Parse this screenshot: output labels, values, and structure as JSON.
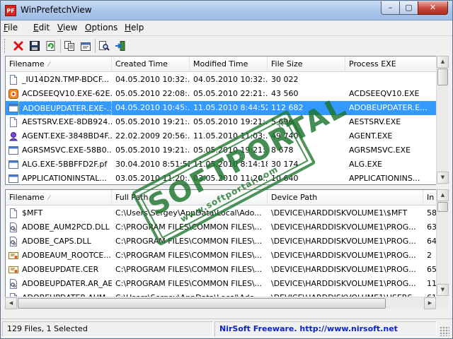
{
  "window": {
    "title": "WinPrefetchView",
    "app_icon_text": "PF",
    "minimize_glyph": "–",
    "maximize_glyph": "▢",
    "close_glyph": "✕"
  },
  "menu": {
    "items": [
      {
        "label": "File",
        "accel": "F"
      },
      {
        "label": "Edit",
        "accel": "E"
      },
      {
        "label": "View",
        "accel": "V"
      },
      {
        "label": "Options",
        "accel": "O"
      },
      {
        "label": "Help",
        "accel": "H"
      }
    ]
  },
  "toolbar": {
    "buttons": [
      {
        "name": "delete-button",
        "icon": "red-x-icon"
      },
      {
        "name": "save-button",
        "icon": "floppy-disk-icon"
      },
      {
        "name": "refresh-button",
        "icon": "refresh-icon"
      },
      {
        "name": "copy-button",
        "icon": "copy-icon"
      },
      {
        "name": "properties-button",
        "icon": "properties-icon"
      },
      {
        "name": "find-button",
        "icon": "find-icon"
      },
      {
        "name": "exit-button",
        "icon": "exit-icon"
      }
    ]
  },
  "top_list": {
    "columns": [
      "Filename",
      "Created Time",
      "Modified Time",
      "File Size",
      "Process EXE"
    ],
    "sorted_column": 0,
    "rows": [
      {
        "icon": "file-icon",
        "cells": [
          "_IU14D2N.TMP-BDCF...",
          "04.05.2010 10:32:...",
          "04.05.2010 10:32:...",
          "30 022",
          ""
        ]
      },
      {
        "icon": "acdsee-icon",
        "cells": [
          "ACDSEEQV10.EXE-62E...",
          "05.05.2010 22:08:...",
          "05.05.2010 22:21:...",
          "43 560",
          "ACDSEEQV10.EXE"
        ]
      },
      {
        "icon": "app-icon",
        "cells": [
          "ADOBEUPDATER.EXE-...",
          "04.05.2010 10:45:...",
          "11.05.2010 8:44:52",
          "112 682",
          "ADOBEUPDATER.E..."
        ],
        "selected": true
      },
      {
        "icon": "file-icon",
        "cells": [
          "AESTSRV.EXE-8DB924...",
          "05.05.2010 19:21:...",
          "05.05.2010 19:21:...",
          "5 696",
          "AESTSRV.EXE"
        ]
      },
      {
        "icon": "agent-icon",
        "cells": [
          "AGENT.EXE-3848BD4F...",
          "22.02.2009 20:56:...",
          "11.05.2010 11:03:...",
          "49 740",
          "AGENT.EXE"
        ]
      },
      {
        "icon": "app-icon",
        "cells": [
          "AGRSMSVC.EXE-58B0...",
          "05.05.2010 19:21:...",
          "05.05.2010 19:21:...",
          "8 678",
          "AGRSMSVC.EXE"
        ]
      },
      {
        "icon": "app-icon",
        "cells": [
          "ALG.EXE-5BBFFD2F.pf",
          "30.04.2010 8:51:52",
          "11.05.2010 8:14:18",
          "30 174",
          "ALG.EXE"
        ]
      },
      {
        "icon": "app-icon",
        "cells": [
          "APPLICATIONINSTAL...",
          "03.05.2010 11:20:...",
          "03.05.2010 11:20:...",
          "10 640",
          "APPLICATIONINS..."
        ]
      }
    ]
  },
  "bottom_list": {
    "columns": [
      "Filename",
      "Full Path",
      "Device Path",
      "In"
    ],
    "sorted_column": 0,
    "rows": [
      {
        "icon": "file-icon",
        "cells": [
          "$MFT",
          "C:\\Users\\Sergey\\AppData\\Local\\Ado...",
          "\\DEVICE\\HARDDISKVOLUME1\\$MFT",
          "58"
        ]
      },
      {
        "icon": "dll-icon",
        "cells": [
          "ADOBE_AUM2PCD.DLL",
          "C:\\PROGRAM FILES\\COMMON FILES\\...",
          "\\DEVICE\\HARDDISKVOLUME1\\PROG...",
          "63"
        ]
      },
      {
        "icon": "dll-icon",
        "cells": [
          "ADOBE_CAPS.DLL",
          "C:\\PROGRAM FILES\\COMMON FILES\\...",
          "\\DEVICE\\HARDDISKVOLUME1\\PROG...",
          "64"
        ]
      },
      {
        "icon": "cert-icon",
        "cells": [
          "ADOBEAUM_ROOTCE...",
          "C:\\PROGRAM FILES\\COMMON FILES\\...",
          "\\DEVICE\\HARDDISKVOLUME1\\PROG...",
          "2"
        ]
      },
      {
        "icon": "cert-icon",
        "cells": [
          "ADOBEUPDATE.CER",
          "C:\\PROGRAM FILES\\COMMON FILES\\...",
          "\\DEVICE\\HARDDISKVOLUME1\\PROG...",
          "65"
        ]
      },
      {
        "icon": "dll-icon",
        "cells": [
          "ADOBEUPDATER.AR_AE",
          "C:\\PROGRAM FILES\\COMMON FILES\\...",
          "\\DEVICE\\HARDDISKVOLUME1\\PROG...",
          "11"
        ]
      },
      {
        "icon": "file-icon",
        "cells": [
          "ADOBEUPDATER.AUM",
          "C:\\Users\\Sergey\\AppData\\Local\\Ado...",
          "\\DEVICE\\HARDDISKVOLUME1\\USERS...",
          "61"
        ]
      },
      {
        "icon": "dll-icon",
        "cells": [
          "ADOBEUPDATER.CZ_CZ",
          "C:\\PROGRAM FILES\\COMMON FILES\\...",
          "\\DEVICE\\HARDDISKVOLUME1\\PROG...",
          "12"
        ]
      }
    ]
  },
  "status": {
    "count_text": "129 Files, 1 Selected",
    "link_text": "NirSoft Freeware.  http://www.nirsoft.net"
  },
  "watermark": {
    "big_text": "SOFTPORTAL",
    "small_text": "www.softportal.com",
    "tm": "TM"
  },
  "colors": {
    "selection": "#3399ff",
    "link": "#0a24c8",
    "stamp": "#1c742c"
  }
}
